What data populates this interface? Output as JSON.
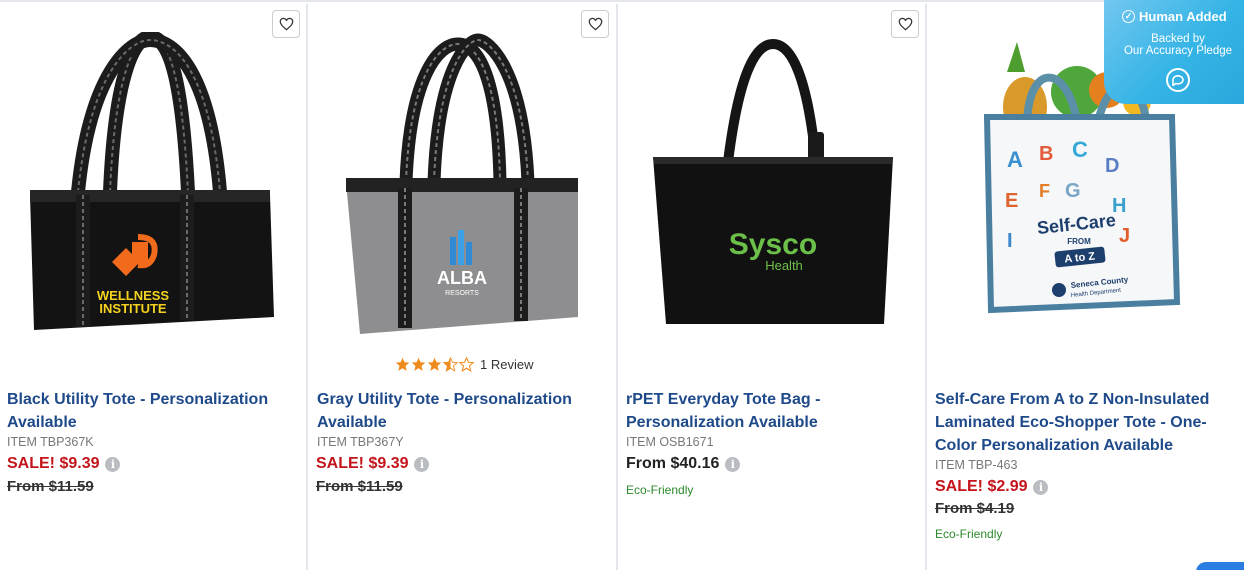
{
  "badge": {
    "title": "Human Added",
    "line1": "Backed by",
    "line2": "Our Accuracy Pledge"
  },
  "products": [
    {
      "title_line1": "Black Utility Tote - Personalization",
      "title_line2": "Available",
      "item": "ITEM TBP367K",
      "sale": "SALE! $9.39",
      "original": "From $11.59",
      "logo_main": "WELLNESS",
      "logo_sub": "INSTITUTE"
    },
    {
      "title_line1": "Gray Utility Tote - Personalization",
      "title_line2": "Available",
      "rating": 3.5,
      "reviews": "1 Review",
      "item": "ITEM TBP367Y",
      "sale": "SALE! $9.39",
      "original": "From $11.59",
      "logo_main": "ALBA",
      "logo_sub": "RESORTS"
    },
    {
      "title_line1": "rPET Everyday Tote Bag -",
      "title_line2": "Personalization Available",
      "item": "ITEM OSB1671",
      "price": "From $40.16",
      "eco": "Eco-Friendly",
      "logo_main": "Sysco",
      "logo_sub": "Health"
    },
    {
      "title_line1": "Self-Care From A to Z Non-Insulated",
      "title_line2": "Laminated Eco-Shopper Tote - One-",
      "title_line3": "Color Personalization Available",
      "item": "ITEM TBP-463",
      "sale": "SALE! $2.99",
      "original": "From $4.19",
      "eco": "Eco-Friendly",
      "logo_main": "Self-Care",
      "logo_from": "FROM",
      "logo_az": "A to Z",
      "logo_org1": "Seneca County",
      "logo_org2": "Health Department"
    }
  ],
  "colors": {
    "title": "#1f4a8a",
    "sale": "#c4141b",
    "eco": "#2c8a2c",
    "star": "#f08a1c"
  },
  "icons": {
    "favorite": "heart-outline-icon",
    "info": "info-circle-icon",
    "star": "star-icon"
  }
}
